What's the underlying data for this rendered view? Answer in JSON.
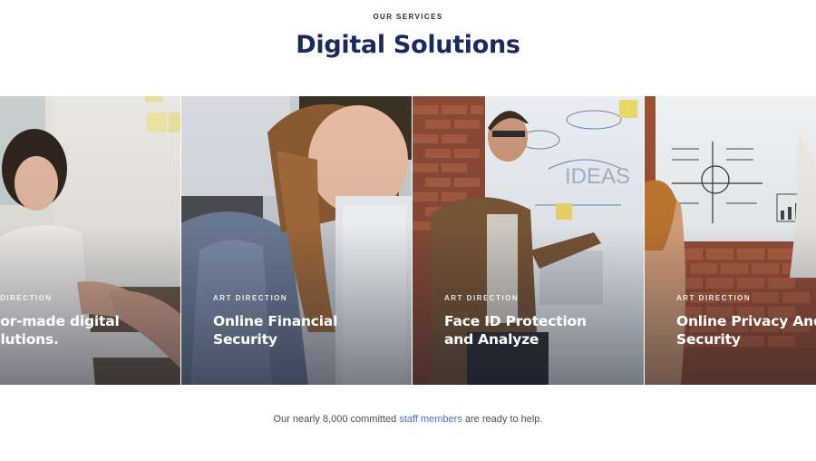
{
  "header": {
    "eyebrow": "OUR SERVICES",
    "title": "Digital Solutions"
  },
  "cards": [
    {
      "label": "T DIRECTION",
      "heading_line1": "ilor-made digital",
      "heading_line2": "olutions."
    },
    {
      "label": "ART DIRECTION",
      "heading_line1": "Online Financial",
      "heading_line2": "Security"
    },
    {
      "label": "ART DIRECTION",
      "heading_line1": "Face ID Protection",
      "heading_line2": "and Analyze"
    },
    {
      "label": "ART DIRECTION",
      "heading_line1": "Online Privacy And",
      "heading_line2": "Security"
    }
  ],
  "footer": {
    "text_before": "Our nearly 8,000 committed ",
    "link": "staff members",
    "text_after": " are ready to help."
  },
  "colors": {
    "title": "#1a2a5e",
    "link": "#4a6fd8"
  }
}
